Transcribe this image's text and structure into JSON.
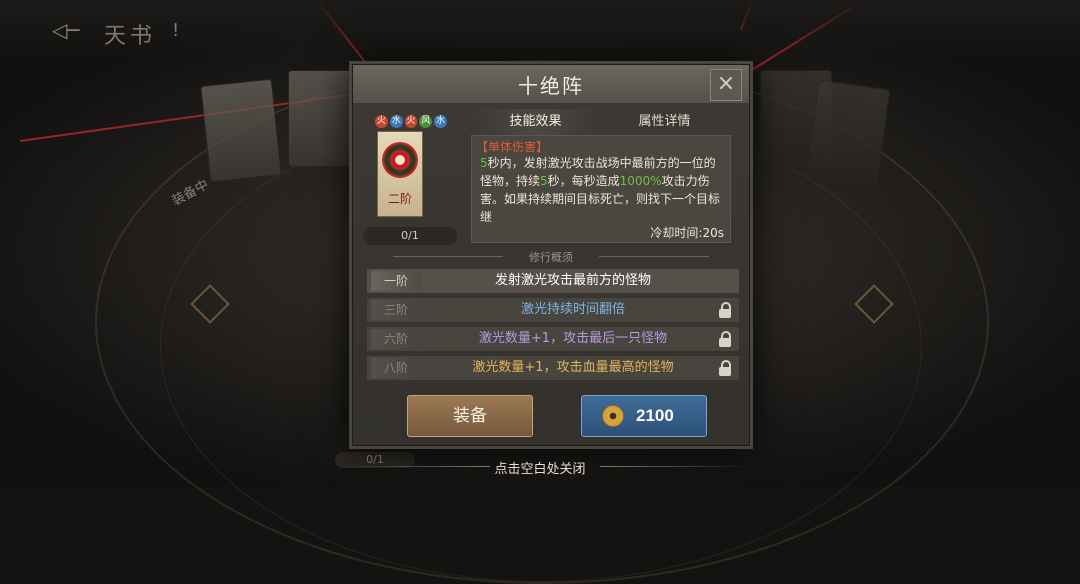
{
  "header": {
    "title": "天书",
    "badge": "!"
  },
  "background": {
    "equip_tag": "装备中",
    "counter": "0/1"
  },
  "dialog": {
    "title": "十绝阵",
    "close_icon": "×",
    "elements": [
      "fire",
      "water",
      "fire",
      "wind",
      "water"
    ],
    "skill_card": {
      "rank": "二阶",
      "count": "0/1"
    },
    "tabs": [
      {
        "label": "技能效果",
        "active": true
      },
      {
        "label": "属性详情",
        "active": false
      }
    ],
    "effect": {
      "type": "【单体伤害】",
      "desc_parts": [
        {
          "text": "5",
          "hl": true
        },
        {
          "text": "秒内，发射激光攻击战场中最前方的一位的怪物，持续",
          "hl": false
        },
        {
          "text": "5",
          "hl": true
        },
        {
          "text": "秒，每秒造成",
          "hl": false
        },
        {
          "text": "1000%",
          "hl": true
        },
        {
          "text": "攻击力伤害。如果持续期间目标死亡，则找下一个目标继",
          "hl": false
        }
      ],
      "cooldown": "冷却时间:20s"
    },
    "section_title": "修行概须",
    "stages": [
      {
        "label": "一阶",
        "text": "发射激光攻击最前方的怪物",
        "color": "#ffffff",
        "locked": false
      },
      {
        "label": "三阶",
        "text": "激光持续时间翻倍",
        "color": "#7fb4e6",
        "locked": true
      },
      {
        "label": "六阶",
        "text": "激光数量+1，攻击最后一只怪物",
        "color": "#b79ae0",
        "locked": true
      },
      {
        "label": "八阶",
        "text": "激光数量+1，攻击血量最高的怪物",
        "color": "#e0b65b",
        "locked": true
      }
    ],
    "equip_button": "装备",
    "buy_price": "2100"
  },
  "footer": {
    "close_hint": "点击空白处关闭"
  }
}
